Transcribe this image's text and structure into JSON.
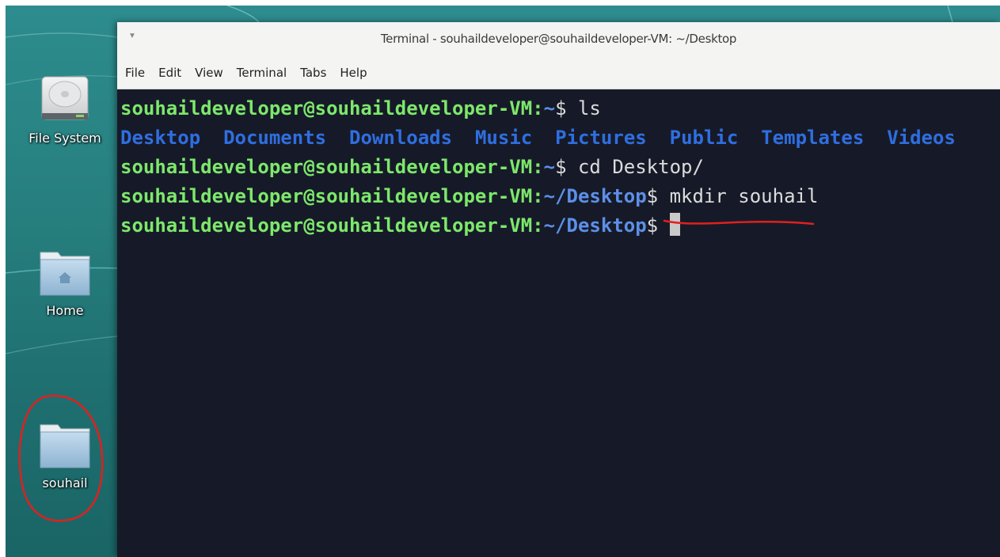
{
  "window": {
    "title": "Terminal - souhaildeveloper@souhaildeveloper-VM: ~/Desktop",
    "menu": [
      "File",
      "Edit",
      "View",
      "Terminal",
      "Tabs",
      "Help"
    ]
  },
  "desktop": {
    "icons": [
      {
        "label": "File System",
        "icon": "drive-icon"
      },
      {
        "label": "Home",
        "icon": "home-folder-icon"
      },
      {
        "label": "souhail",
        "icon": "folder-icon"
      }
    ]
  },
  "terminal": {
    "prompt_user": "souhaildeveloper@souhaildeveloper-VM",
    "sep": ":",
    "home_path": "~",
    "desktop_path": "~/Desktop",
    "sign": "$",
    "cmd1": "ls",
    "ls_output": [
      "Desktop",
      "Documents",
      "Downloads",
      "Music",
      "Pictures",
      "Public",
      "Templates",
      "Videos"
    ],
    "cmd2": "cd Desktop/",
    "cmd3": "mkdir souhail",
    "cmd4": ""
  },
  "colors": {
    "prompt": "#7de86b",
    "directory": "#2f6ee0",
    "terminal_bg": "#161a28",
    "annotation": "#e0201e"
  }
}
